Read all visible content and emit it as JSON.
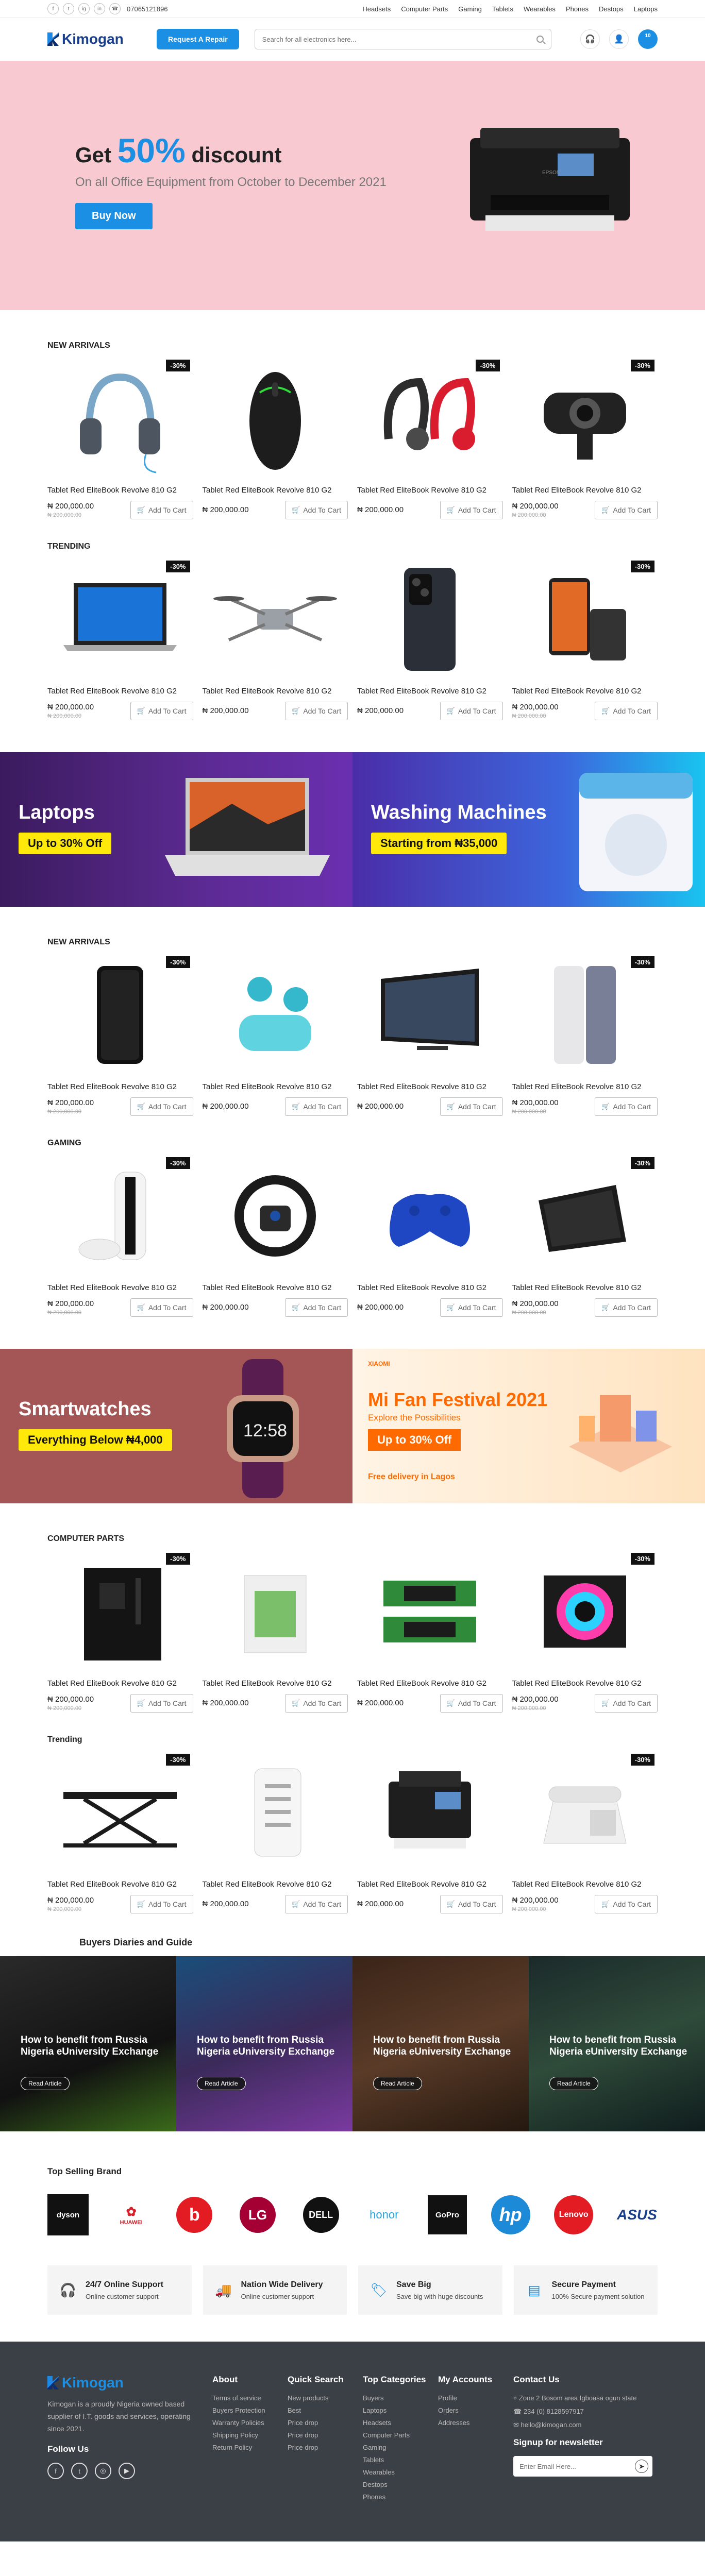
{
  "topbar": {
    "socials": [
      "f",
      "t",
      "ig",
      "in"
    ],
    "phone": "07065121896",
    "nav": [
      "Headsets",
      "Computer Parts",
      "Gaming",
      "Tablets",
      "Wearables",
      "Phones",
      "Destops",
      "Laptops"
    ]
  },
  "header": {
    "logo": "Kimogan",
    "repair_label": "Request A Repair",
    "search_placeholder": "Search for all electronics here...",
    "cart_count": "10"
  },
  "hero": {
    "get": "Get",
    "percent": "50%",
    "discount": "discount",
    "subtitle": "On all Office Equipment from October to December 2021",
    "button": "Buy Now"
  },
  "product": {
    "name": "Tablet Red EliteBook Revolve 810 G2",
    "price": "₦ 200,000.00",
    "old_price": "₦ 200,000.00",
    "add_label": "Add To Cart",
    "badge": "-30%"
  },
  "sections": {
    "s1": "NEW ARRIVALS",
    "s2": "TRENDING",
    "s3": "NEW ARRIVALS",
    "s4": "GAMING",
    "s5": "COMPUTER PARTS",
    "s6": "Trending"
  },
  "banners": {
    "laptops": "Laptops",
    "laptops_pill": "Up to 30% Off",
    "washing": "Washing Machines",
    "washing_pill": "Starting from ₦35,000",
    "watch": "Smartwatches",
    "watch_pill": "Everything Below ₦4,000",
    "fan_brand": "XIAOMI",
    "fan_title": "Mi Fan Festival 2021",
    "fan_sub": "Explore the Possibilities",
    "fan_pill": "Up to 30% Off",
    "fan_delivery": "Free delivery in Lagos"
  },
  "blog": {
    "title": "Buyers Diaries and Guide",
    "post_title": "How to benefit from  Russia Nigeria eUniversity Exchange",
    "read": "Read Article"
  },
  "brands": {
    "title": "Top Selling Brand",
    "items": [
      "dyson",
      "HUAWEI",
      "b",
      "LG",
      "DELL",
      "honor",
      "GoPro",
      "hp",
      "Lenovo",
      "ASUS"
    ]
  },
  "features": [
    {
      "icon": "headset-icon",
      "title": "24/7 Online Support",
      "sub": "Online customer support"
    },
    {
      "icon": "truck-icon",
      "title": "Nation Wide Delivery",
      "sub": "Online customer support"
    },
    {
      "icon": "tag-icon",
      "title": "Save Big",
      "sub": "Save  big with huge discounts"
    },
    {
      "icon": "card-icon",
      "title": "Secure Payment",
      "sub": "100% Secure payment  solution"
    }
  ],
  "footer": {
    "logo": "Kimogan",
    "about": "Kimogan is a proudly Nigeria owned based supplier of I.T. goods and services, operating since 2021.",
    "follow": "Follow Us",
    "about_title": "About",
    "about_links": [
      "Terms of service",
      "Buyers Protection",
      "Warranty Policies",
      "Shipping Policy",
      "Return Policy"
    ],
    "quick_title": "Quick Search",
    "quick_links": [
      "New products",
      "Best",
      "Price drop",
      "Price drop",
      "Price drop"
    ],
    "cat_title": "Top Categories",
    "cat_links": [
      "Buyers",
      "Laptops",
      "Headsets",
      "Computer Parts",
      "Gaming",
      "Tablets",
      "Wearables",
      "Destops",
      "Phones"
    ],
    "acc_title": "My Accounts",
    "acc_links": [
      "Profile",
      "Orders",
      "Addresses"
    ],
    "contact_title": "Contact Us",
    "address": "Zone 2 Bosom area Igboasa ogun state",
    "phone": "234 (0) 8128597917",
    "email": "hello@kimogan.com",
    "newsletter": "Signup for newsletter",
    "email_placeholder": "Enter Email Here..."
  }
}
